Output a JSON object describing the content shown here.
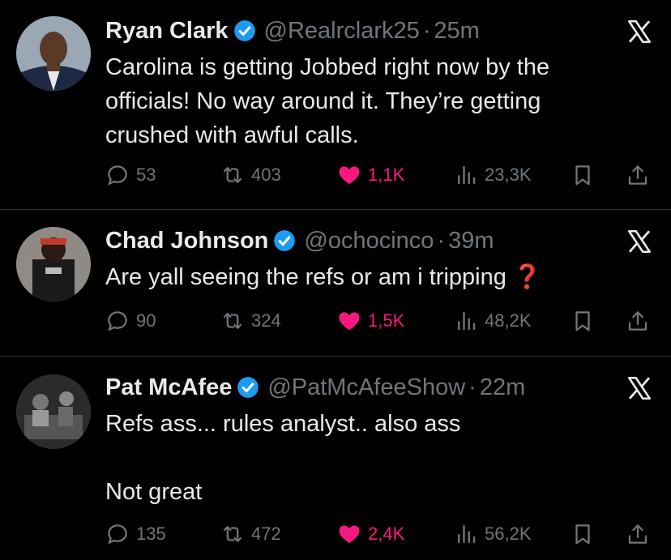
{
  "tweets": [
    {
      "name": "Ryan Clark",
      "handle": "@Realrclark25",
      "separator": "·",
      "time": "25m",
      "text": "Carolina is getting Jobbed right now by the officials! No way around it. They’re getting crushed with awful calls.",
      "replies": "53",
      "reposts": "403",
      "likes": "1,1K",
      "views": "23,3K"
    },
    {
      "name": "Chad Johnson",
      "handle": "@ochocinco",
      "separator": "·",
      "time": "39m",
      "text": "Are yall seeing the refs or am i tripping ❓",
      "replies": "90",
      "reposts": "324",
      "likes": "1,5K",
      "views": "48,2K"
    },
    {
      "name": "Pat McAfee",
      "handle": "@PatMcAfeeShow",
      "separator": "·",
      "time": "22m",
      "text": "Refs ass... rules analyst.. also ass\n\nNot great",
      "replies": "135",
      "reposts": "472",
      "likes": "2,4K",
      "views": "56,2K"
    }
  ],
  "colors": {
    "background": "#000000",
    "text": "#e7e9ea",
    "muted": "#71767b",
    "like": "#f91880",
    "verified": "#1d9bf0",
    "divider": "#2f3336"
  },
  "icons": [
    "verified-badge-icon",
    "x-logo-icon",
    "reply-icon",
    "repost-icon",
    "heart-icon",
    "views-icon",
    "bookmark-icon",
    "share-icon"
  ]
}
